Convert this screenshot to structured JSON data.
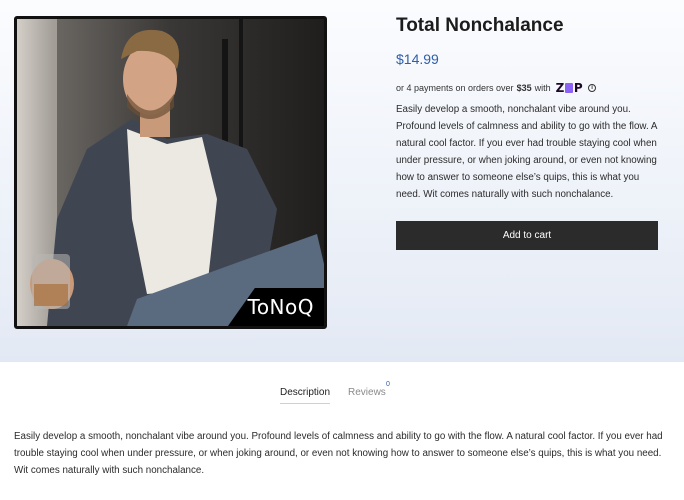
{
  "product": {
    "title": "Total Nonchalance",
    "price": "$14.99",
    "image_watermark": "ToNoQ",
    "installments": {
      "prefix": "or 4 payments on orders over",
      "threshold": "$35",
      "suffix": "with",
      "provider_logo": "zip",
      "info_icon": "info-icon"
    },
    "short_description": "Easily develop a smooth, nonchalant vibe around you. Profound levels of calmness and ability to go with the flow. A natural cool factor. If you ever had trouble staying cool when under pressure, or when joking around, or even not knowing how to answer to someone else’s quips, this is what you need. Wit comes naturally with such nonchalance.",
    "add_to_cart_label": "Add to cart"
  },
  "tabs": [
    {
      "label": "Description",
      "active": true
    },
    {
      "label": "Reviews",
      "count": "0",
      "active": false
    }
  ],
  "description_body": "Easily develop a smooth, nonchalant vibe around you. Profound levels of calmness and ability to go with the flow. A natural cool factor. If you ever had trouble staying cool when under pressure, or when joking around, or even not knowing how to answer to someone else’s quips, this is what you need. Wit comes naturally with such nonchalance.",
  "colors": {
    "price": "#2f5faa",
    "button_bg": "#2b2b2b",
    "zip_accent": "#8b63f5"
  }
}
